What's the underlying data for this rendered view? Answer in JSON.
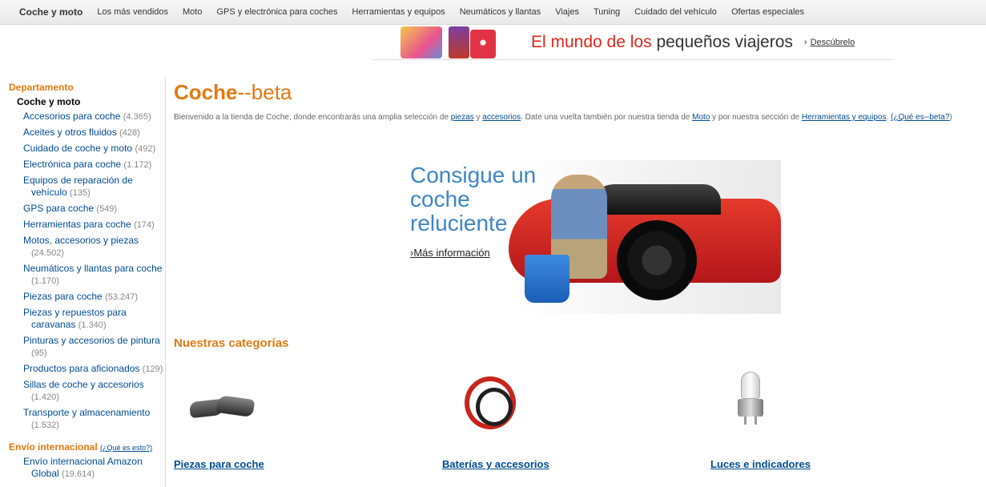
{
  "topnav": {
    "brand": "Coche y moto",
    "links": [
      "Los más vendidos",
      "Moto",
      "GPS y electrónica para coches",
      "Herramientas y equipos",
      "Neumáticos y llantas",
      "Viajes",
      "Tuning",
      "Cuidado del vehículo",
      "Ofertas especiales"
    ]
  },
  "banner": {
    "text_red": "El mundo de los ",
    "text_dark": "pequeños viajeros",
    "link": "Descúbrelo",
    "arrow": "›"
  },
  "sidebar": {
    "title": "Departamento",
    "current": "Coche y moto",
    "items": [
      {
        "label": "Accesorios para coche",
        "count": "(4.365)"
      },
      {
        "label": "Aceites y otros fluidos",
        "count": "(428)"
      },
      {
        "label": "Cuidado de coche y moto",
        "count": "(492)"
      },
      {
        "label": "Electrónica para coche",
        "count": "(1.172)"
      },
      {
        "label": "Equipos de reparación de vehículo",
        "count": "(135)"
      },
      {
        "label": "GPS para coche",
        "count": "(549)"
      },
      {
        "label": "Herramientas para coche",
        "count": "(174)"
      },
      {
        "label": "Motos, accesorios y piezas",
        "count": "(24.502)"
      },
      {
        "label": "Neumáticos y llantas para coche",
        "count": "(1.170)"
      },
      {
        "label": "Piezas para coche",
        "count": "(53.247)"
      },
      {
        "label": "Piezas y repuestos para caravanas",
        "count": "(1.340)"
      },
      {
        "label": "Pinturas y accesorios de pintura",
        "count": "(95)"
      },
      {
        "label": "Productos para aficionados",
        "count": "(129)"
      },
      {
        "label": "Sillas de coche y accesorios",
        "count": "(1.420)"
      },
      {
        "label": "Transporte y almacenamiento",
        "count": "(1.532)"
      }
    ],
    "intl_title": "Envío internacional",
    "intl_help": "(¿Qué es esto?)",
    "intl_items": [
      {
        "label": "Envío internacional Amazon Global",
        "count": "(19.614)"
      }
    ]
  },
  "main": {
    "title_bold": "Coche",
    "title_rest": "--beta",
    "intro": {
      "t1": "Bienvenido a la tienda de Coche, donde encontrarás una amplia selección de ",
      "l1": "piezas",
      "t2": " y ",
      "l2": "accesorios",
      "t3": ". Date una vuelta también por nuestra tienda de ",
      "l3": "Moto",
      "t4": " y por nuestra sección de ",
      "l4": "Herramientas y equipos",
      "t5": ". ",
      "l5": "(¿Qué es--beta?",
      "t6": ")"
    },
    "hero": {
      "headline": "Consigue un coche reluciente",
      "link": "Más información",
      "arrow": "›"
    },
    "categories_title": "Nuestras categorías",
    "categories": [
      {
        "label": "Piezas para coche",
        "icon": "brake-pads-icon"
      },
      {
        "label": "Baterías y accesorios",
        "icon": "jumper-cables-icon"
      },
      {
        "label": "Luces e indicadores",
        "icon": "headlight-bulb-icon"
      }
    ]
  }
}
